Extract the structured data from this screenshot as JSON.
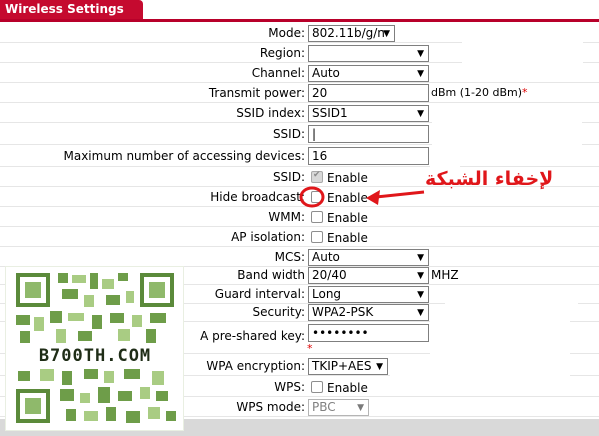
{
  "header": {
    "title": "Wireless Settings"
  },
  "fields": {
    "mode": {
      "label": "Mode:",
      "value": "802.11b/g/n"
    },
    "region": {
      "label": "Region:",
      "value": ""
    },
    "channel": {
      "label": "Channel:",
      "value": "Auto"
    },
    "transmit_power": {
      "label": "Transmit power:",
      "value": "20",
      "unit": "dBm (1-20 dBm)",
      "required": "*"
    },
    "ssid_index": {
      "label": "SSID index:",
      "value": "SSID1"
    },
    "ssid": {
      "label": "SSID:",
      "value": "|"
    },
    "max_devices": {
      "label": "Maximum number of accessing devices:",
      "value": "16"
    },
    "ssid_enable": {
      "label": "SSID:",
      "option": "Enable",
      "checked": true
    },
    "hide_broadcast": {
      "label": "Hide broadcast:",
      "option": "Enable",
      "checked": false
    },
    "wmm": {
      "label": "WMM:",
      "option": "Enable",
      "checked": false
    },
    "ap_isolation": {
      "label": "AP isolation:",
      "option": "Enable",
      "checked": false
    },
    "mcs": {
      "label": "MCS:",
      "value": "Auto"
    },
    "band_width": {
      "label": "Band width",
      "value": "20/40",
      "unit": "MHZ"
    },
    "guard_interval": {
      "label": "Guard interval:",
      "value": "Long"
    },
    "security": {
      "label": "Security:",
      "value": "WPA2-PSK"
    },
    "preshared_key": {
      "label": "A pre-shared key:",
      "value": "••••••••",
      "required": "*"
    },
    "wpa_encryption": {
      "label": "WPA encryption:",
      "value": "TKIP+AES"
    },
    "wps": {
      "label": "WPS:",
      "option": "Enable",
      "checked": false
    },
    "wps_mode": {
      "label": "WPS mode:",
      "value": "PBC"
    }
  },
  "annotation": {
    "text": "لإخفاء الشبكة",
    "color": "#e0161a"
  },
  "watermark": {
    "text": "B700TH.COM"
  },
  "colors": {
    "header_red": "#c50a2f",
    "annotation_red": "#e0161a",
    "qr_green": "#6e9d49"
  }
}
